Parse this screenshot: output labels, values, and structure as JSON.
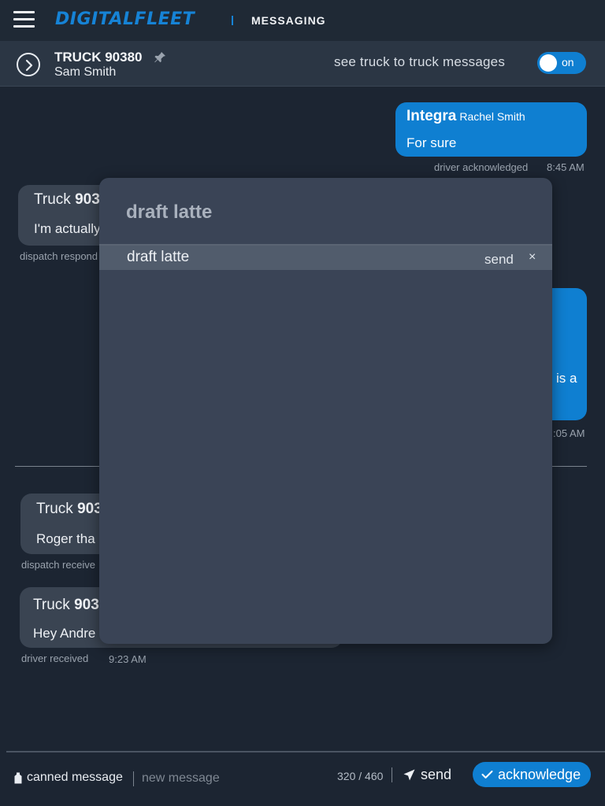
{
  "topbar": {
    "logo": "DIGITALFLEET",
    "section": "MESSAGING"
  },
  "conversation": {
    "truck": "TRUCK 90380",
    "driver": "Sam Smith",
    "toggle_label": "see truck to truck messages",
    "toggle_state": "on"
  },
  "messages": [
    {
      "direction": "out",
      "sender": "Integra",
      "sender_sub": "Rachel Smith",
      "body": "For sure",
      "status": "driver acknowledged",
      "time": "8:45 AM"
    },
    {
      "direction": "in",
      "sender_prefix": "Truck ",
      "sender_bold": "903",
      "body": "I'm actually",
      "status": "dispatch respond"
    },
    {
      "direction": "out",
      "body": "is a",
      "time": ":05 AM"
    },
    {
      "direction": "in",
      "sender_prefix": "Truck ",
      "sender_bold": "903",
      "body": "Roger tha",
      "status": "dispatch receive"
    },
    {
      "direction": "in",
      "sender_prefix": "Truck ",
      "sender_bold": "903",
      "body": "Hey Andre",
      "status": "driver received",
      "time": "9:23 AM"
    }
  ],
  "drafts_modal": {
    "title": "draft latte",
    "items": [
      {
        "text": "draft latte",
        "send_label": "send",
        "close_label": "×"
      }
    ]
  },
  "composer": {
    "canned_label": "canned message",
    "placeholder": "new message",
    "counter": "320 / 460",
    "send_label": "send",
    "acknowledge_label": "acknowledge"
  },
  "colors": {
    "background": "#1c2532",
    "accent": "#0f7fd1",
    "incoming_bubble": "#3a4452",
    "modal": "#3a4456"
  }
}
